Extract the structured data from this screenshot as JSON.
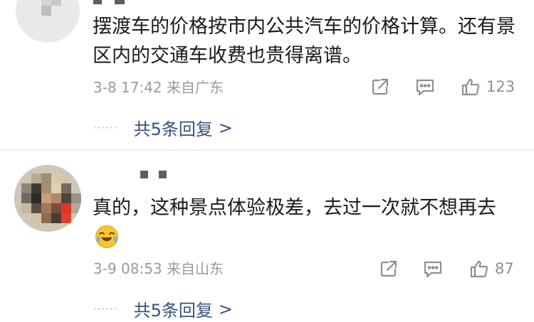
{
  "comments": [
    {
      "text": "摆渡车的价格按市内公共汽车的价格计算。还有景区内的交通车收费也贵得离谱。",
      "meta": "3-8 17:42 来自广东",
      "likes": "123",
      "replies_label": "共5条回复",
      "reply_dots": "······",
      "chevron": ">"
    },
    {
      "text": "真的，这种景点体验极差，去过一次就不想再去",
      "meta": "3-9 08:53 来自山东",
      "likes": "87",
      "replies_label": "共5条回复",
      "reply_dots": "······",
      "chevron": ">",
      "emoji": "laughing-crying-emoji"
    }
  ],
  "icons": {
    "share": "share-icon",
    "comment": "comment-icon",
    "like": "like-icon"
  },
  "colors": {
    "link": "#39517f",
    "meta": "#9a9a9a",
    "text": "#1a1a1a",
    "emoji": "#f5c631"
  }
}
